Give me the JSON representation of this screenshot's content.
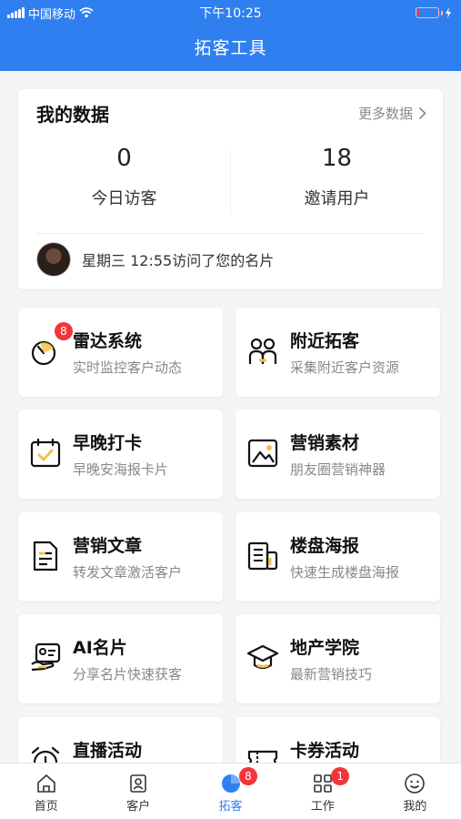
{
  "status_bar": {
    "carrier": "中国移动",
    "time": "下午10:25"
  },
  "page_title": "拓客工具",
  "data_card": {
    "title": "我的数据",
    "more_label": "更多数据",
    "stats": [
      {
        "value": "0",
        "label": "今日访客"
      },
      {
        "value": "18",
        "label": "邀请用户"
      }
    ],
    "visit_text": "星期三 12:55访问了您的名片"
  },
  "tools": [
    {
      "title": "雷达系统",
      "subtitle": "实时监控客户动态",
      "icon": "radar-icon",
      "badge": "8"
    },
    {
      "title": "附近拓客",
      "subtitle": "采集附近客户资源",
      "icon": "people-icon"
    },
    {
      "title": "早晚打卡",
      "subtitle": "早晚安海报卡片",
      "icon": "calendar-check-icon"
    },
    {
      "title": "营销素材",
      "subtitle": "朋友圈营销神器",
      "icon": "image-icon"
    },
    {
      "title": "营销文章",
      "subtitle": "转发文章激活客户",
      "icon": "document-icon"
    },
    {
      "title": "楼盘海报",
      "subtitle": "快速生成楼盘海报",
      "icon": "building-poster-icon"
    },
    {
      "title": "AI名片",
      "subtitle": "分享名片快速获客",
      "icon": "card-hand-icon"
    },
    {
      "title": "地产学院",
      "subtitle": "最新营销技巧",
      "icon": "graduation-cap-icon"
    },
    {
      "title": "直播活动",
      "subtitle": "",
      "icon": "alarm-clock-icon"
    },
    {
      "title": "卡券活动",
      "subtitle": "",
      "icon": "coupon-icon"
    }
  ],
  "tabbar": {
    "items": [
      {
        "label": "首页",
        "icon": "home-icon"
      },
      {
        "label": "客户",
        "icon": "contact-icon"
      },
      {
        "label": "拓客",
        "icon": "pie-icon",
        "badge": "8",
        "active": true
      },
      {
        "label": "工作",
        "icon": "grid-icon",
        "badge": "1"
      },
      {
        "label": "我的",
        "icon": "smile-icon"
      }
    ]
  },
  "colors": {
    "primary": "#2f7ff0",
    "badge": "#f2353a",
    "background": "#f4f5f7"
  }
}
